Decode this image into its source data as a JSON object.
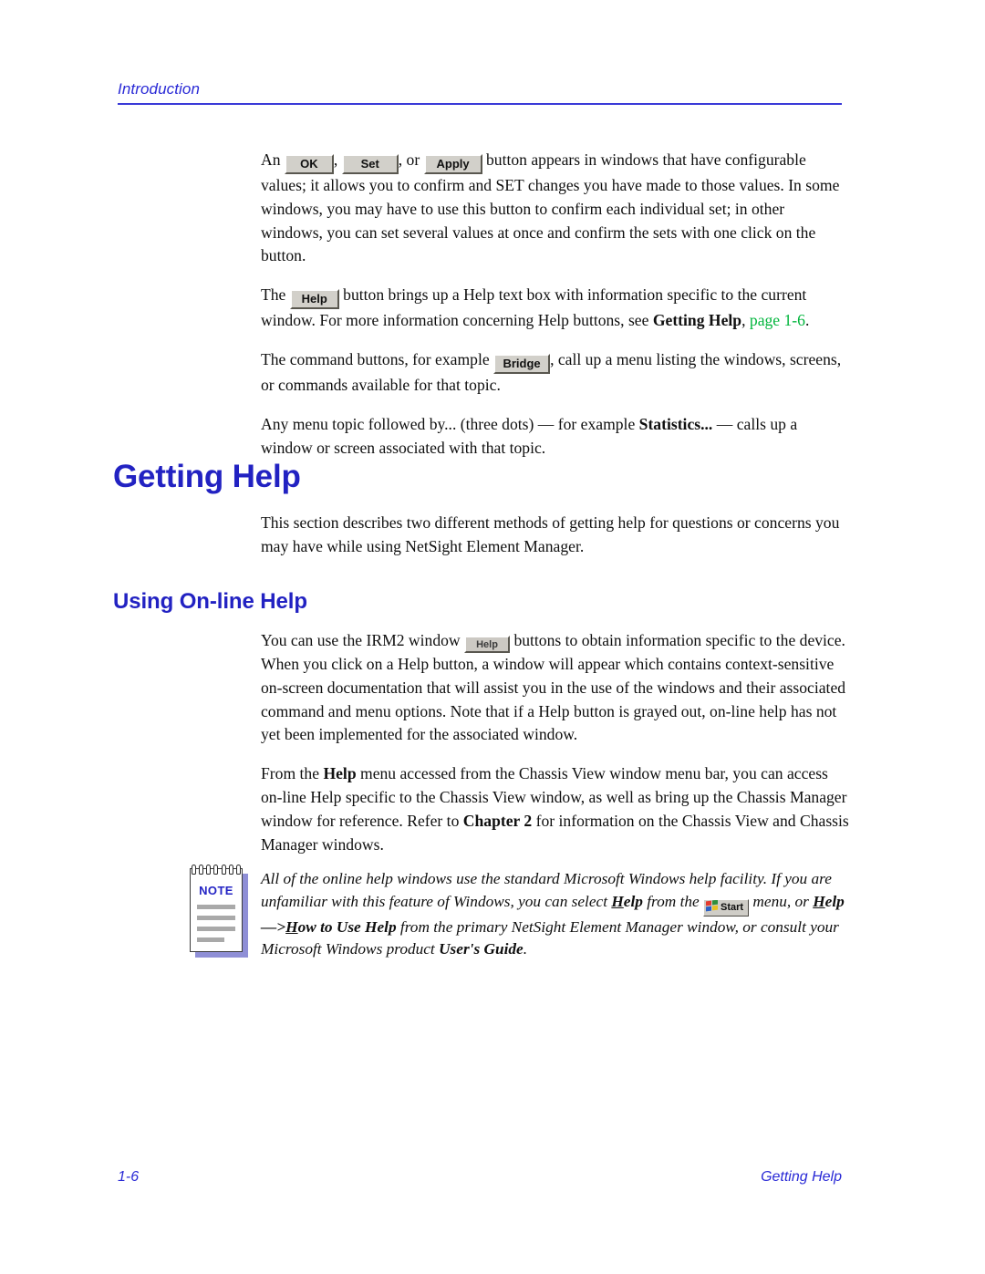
{
  "header": {
    "running_head": "Introduction"
  },
  "paragraphs": {
    "p1": {
      "lead": "An",
      "btn_ok": "OK",
      "sep1": ",",
      "btn_set": "Set",
      "sep2": ", or",
      "btn_apply": "Apply",
      "rest": "button appears in windows that have configurable values; it allows you to confirm and SET changes you have made to those values. In some windows, you may have to use this button to confirm each individual set; in other windows, you can set several values at once and confirm the sets with one click on the button."
    },
    "p2": {
      "lead": "The",
      "btn_help": "Help",
      "mid": "button brings up a Help text box with information specific to the current window. For more information concerning Help buttons, see",
      "bold_ref": "Getting Help",
      "comma": ",",
      "link": "page 1-6",
      "period": "."
    },
    "p3": {
      "lead": "The command buttons, for example",
      "btn_bridge": "Bridge",
      "rest": ", call up a menu listing the windows, screens, or commands available for that topic."
    },
    "p4": {
      "lead": "Any menu topic followed by... (three dots) — for example",
      "bold_term": "Statistics...",
      "rest": "— calls up a window or screen associated with that topic."
    }
  },
  "headings": {
    "getting_help": "Getting Help",
    "using_online_help": "Using On-line Help"
  },
  "sections": {
    "getting_help_intro": "This section describes two different methods of getting help for questions or concerns you may have while using NetSight Element Manager.",
    "online": {
      "p1_lead": "You can use the IRM2 window",
      "p1_btn_help": "Help",
      "p1_rest": "buttons to obtain information specific to the device. When you click on a Help button, a window will appear which contains context-sensitive on-screen documentation that will assist you in the use of the windows and their associated command and menu options. Note that if a Help button is grayed out, on-line help has not yet been implemented for the associated window.",
      "p2_lead": "From the",
      "p2_bold1": "Help",
      "p2_mid": "menu accessed from the Chassis View window menu bar, you can access on-line Help specific to the Chassis View window, as well as bring up the Chassis Manager window for reference. Refer to",
      "p2_bold2": "Chapter 2",
      "p2_rest": "for information on the Chassis View and Chassis Manager windows."
    }
  },
  "note": {
    "label": "NOTE",
    "line_a": "All of the online help windows use the standard Microsoft Windows help facility. If you are unfamiliar with this feature of Windows, you can select",
    "help_u1": "H",
    "help_rest1": "elp",
    "from_the": "from the",
    "start_label": "Start",
    "menu_word": "menu,",
    "or_word": "or",
    "help_u2": "H",
    "help_rest2": "elp",
    "arrow": "—>",
    "how_u": "H",
    "how_rest": "ow to Use Help",
    "line_b": "from the primary NetSight Element Manager window, or consult your Microsoft Windows product",
    "users_guide": "User's Guide",
    "end_period": "."
  },
  "footer": {
    "page_number": "1-6",
    "section_name": "Getting Help"
  },
  "colors": {
    "heading_blue": "#2222c2",
    "running_head_blue": "#2a2ad6",
    "link_green": "#00b53c",
    "note_shadow": "#8f8fd6"
  }
}
